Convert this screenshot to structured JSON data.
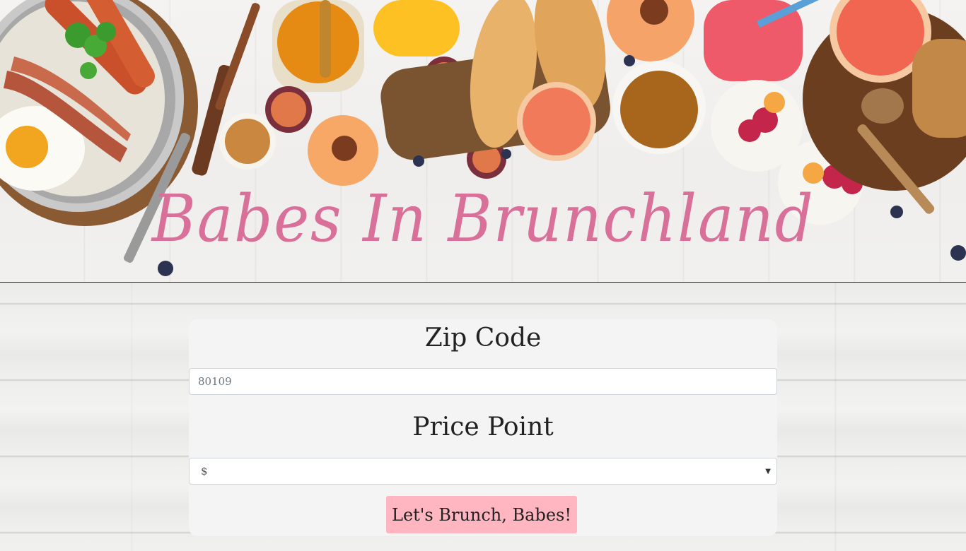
{
  "header": {
    "title": "Babes In Brunchland"
  },
  "form": {
    "zip_heading": "Zip Code",
    "zip_placeholder": "80109",
    "zip_value": "",
    "price_heading": "Price Point",
    "price_selected": "$",
    "submit_label": "Let's Brunch, Babes!"
  },
  "colors": {
    "title_pink": "#d9709a",
    "button_pink": "#ffb6c1",
    "card_bg": "#f4f4f4"
  },
  "icons": {
    "select_caret": "chevron-down-icon"
  }
}
